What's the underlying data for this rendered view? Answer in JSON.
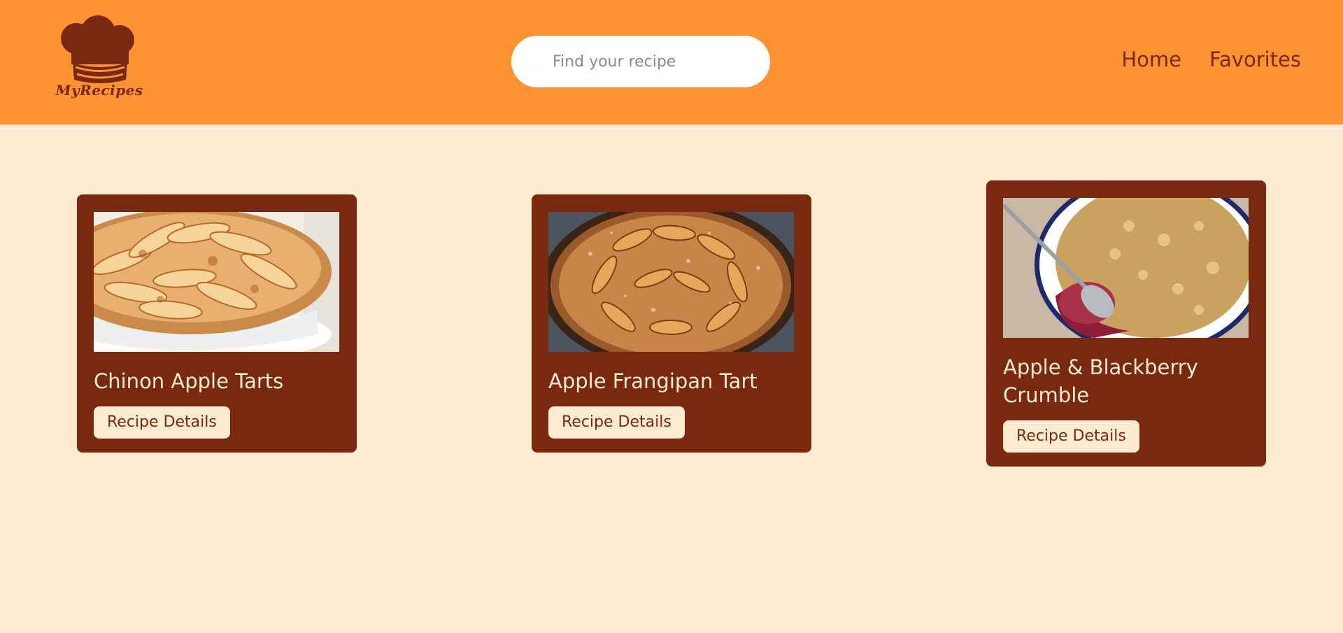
{
  "header": {
    "logo_text": "MyRecipes",
    "search": {
      "placeholder": "Find your recipe",
      "value": ""
    },
    "nav": [
      {
        "label": "Home"
      },
      {
        "label": "Favorites"
      }
    ]
  },
  "colors": {
    "header_bg": "#ff9233",
    "page_bg": "#ffebd1",
    "card_bg": "#7a2911",
    "card_text": "#ffebd1"
  },
  "cards": [
    {
      "title": "Chinon Apple Tarts",
      "button_label": "Recipe Details",
      "image": "apple-tart-photo"
    },
    {
      "title": "Apple Frangipan Tart",
      "button_label": "Recipe Details",
      "image": "frangipan-tart-photo"
    },
    {
      "title": "Apple & Blackberry Crumble",
      "button_label": "Recipe Details",
      "image": "crumble-photo"
    }
  ]
}
